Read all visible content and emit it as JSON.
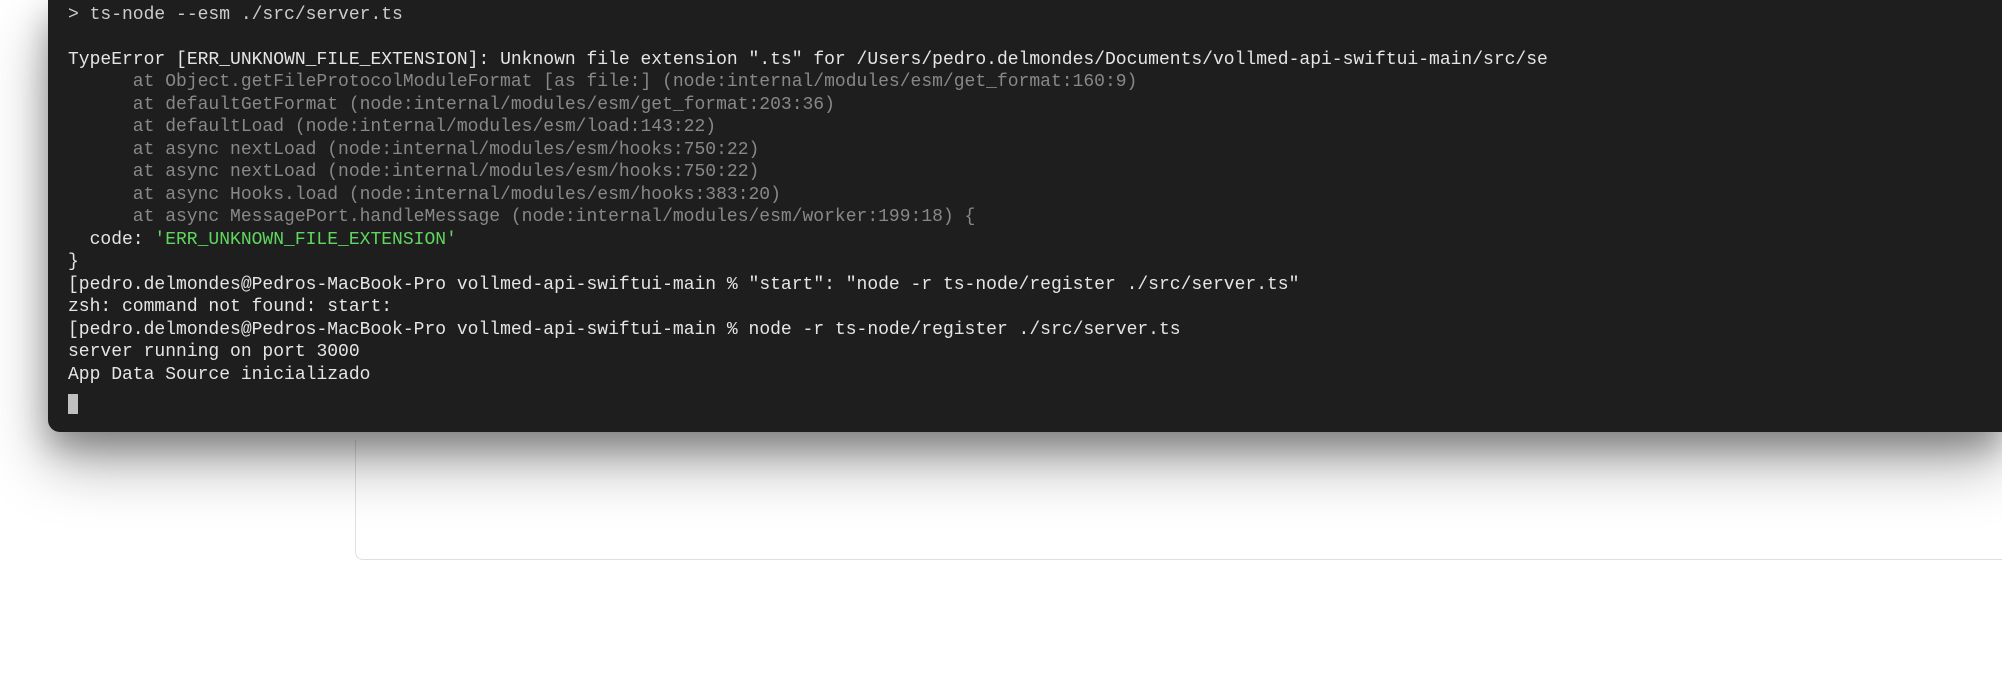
{
  "terminal": {
    "command_line": "> ts-node --esm ./src/server.ts",
    "error_line": "TypeError [ERR_UNKNOWN_FILE_EXTENSION]: Unknown file extension \".ts\" for /Users/pedro.delmondes/Documents/vollmed-api-swiftui-main/src/se",
    "stack": [
      "at Object.getFileProtocolModuleFormat [as file:] (node:internal/modules/esm/get_format:160:9)",
      "at defaultGetFormat (node:internal/modules/esm/get_format:203:36)",
      "at defaultLoad (node:internal/modules/esm/load:143:22)",
      "at async nextLoad (node:internal/modules/esm/hooks:750:22)",
      "at async nextLoad (node:internal/modules/esm/hooks:750:22)",
      "at async Hooks.load (node:internal/modules/esm/hooks:383:20)",
      "at async MessagePort.handleMessage (node:internal/modules/esm/worker:199:18) {"
    ],
    "code_label": "code: ",
    "code_value": "'ERR_UNKNOWN_FILE_EXTENSION'",
    "close_brace": "}",
    "prompt1": "[pedro.delmondes@Pedros-MacBook-Pro vollmed-api-swiftui-main % \"start\": \"node -r ts-node/register ./src/server.ts\"",
    "zsh_error": "zsh: command not found: start:",
    "prompt2": "[pedro.delmondes@Pedros-MacBook-Pro vollmed-api-swiftui-main % node -r ts-node/register ./src/server.ts",
    "output1": "server running on port 3000",
    "output2": "App Data Source inicializado"
  }
}
